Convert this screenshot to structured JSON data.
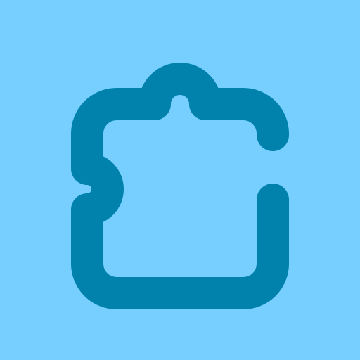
{
  "icon": {
    "name": "puzzle-piece-icon",
    "background_color": "#77CFFF",
    "stroke_color": "#0082AD"
  }
}
